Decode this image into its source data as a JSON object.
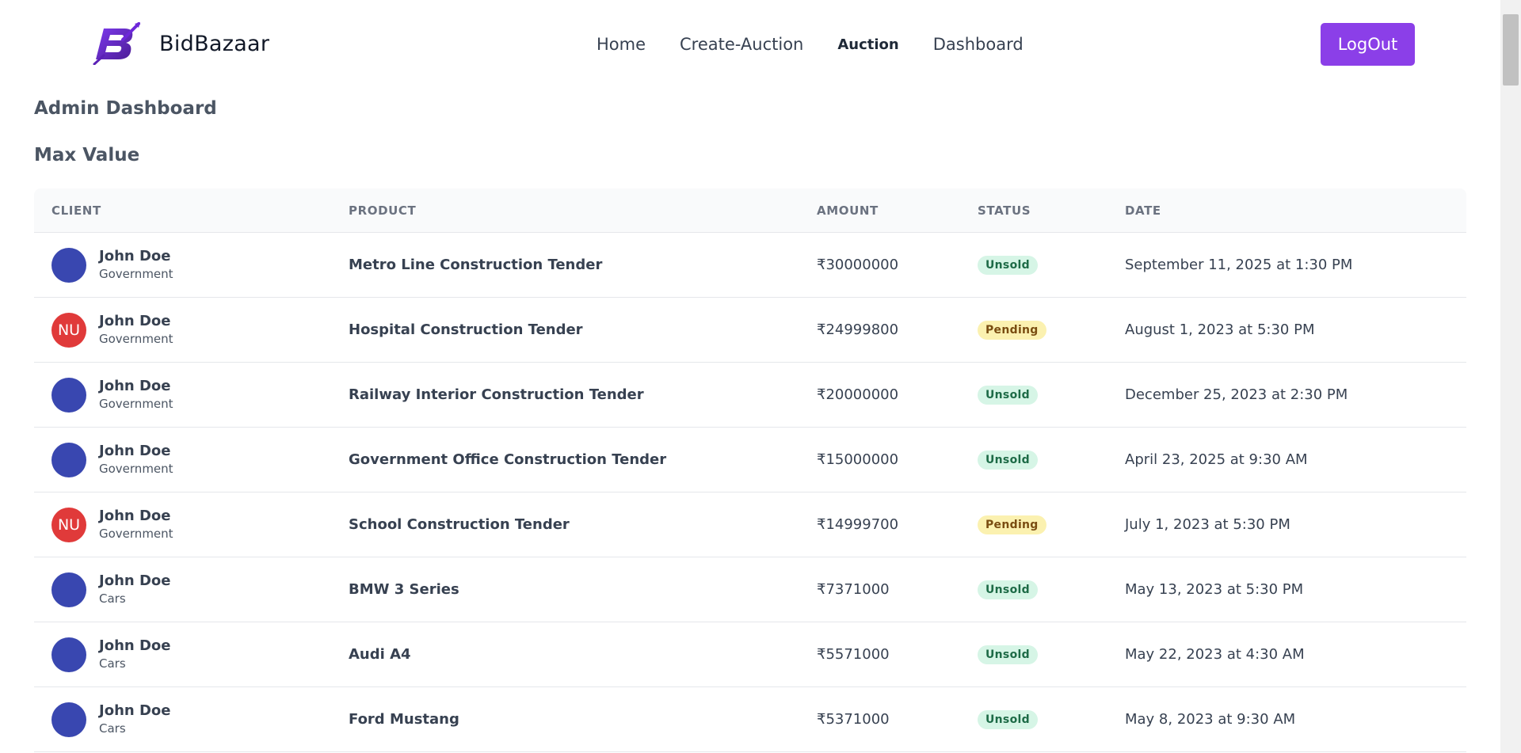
{
  "header": {
    "brand_name": "BidBazaar",
    "nav": [
      {
        "label": "Home"
      },
      {
        "label": "Create-Auction"
      },
      {
        "label": "Auction"
      },
      {
        "label": "Dashboard"
      }
    ],
    "logout_label": "LogOut"
  },
  "page_title": "Admin Dashboard",
  "section_title": "Max Value",
  "table": {
    "columns": [
      "CLIENT",
      "PRODUCT",
      "AMOUNT",
      "STATUS",
      "DATE"
    ],
    "rows": [
      {
        "client_name": "John Doe",
        "client_category": "Government",
        "avatar_initials": "",
        "product": "Metro Line Construction Tender",
        "amount": "₹30000000",
        "status": "Unsold",
        "date": "September 11, 2025 at 1:30 PM"
      },
      {
        "client_name": "John Doe",
        "client_category": "Government",
        "avatar_initials": "NU",
        "product": "Hospital Construction Tender",
        "amount": "₹24999800",
        "status": "Pending",
        "date": "August 1, 2023 at 5:30 PM"
      },
      {
        "client_name": "John Doe",
        "client_category": "Government",
        "avatar_initials": "",
        "product": "Railway Interior Construction Tender",
        "amount": "₹20000000",
        "status": "Unsold",
        "date": "December 25, 2023 at 2:30 PM"
      },
      {
        "client_name": "John Doe",
        "client_category": "Government",
        "avatar_initials": "",
        "product": "Government Office Construction Tender",
        "amount": "₹15000000",
        "status": "Unsold",
        "date": "April 23, 2025 at 9:30 AM"
      },
      {
        "client_name": "John Doe",
        "client_category": "Government",
        "avatar_initials": "NU",
        "product": "School Construction Tender",
        "amount": "₹14999700",
        "status": "Pending",
        "date": "July 1, 2023 at 5:30 PM"
      },
      {
        "client_name": "John Doe",
        "client_category": "Cars",
        "avatar_initials": "",
        "product": "BMW 3 Series",
        "amount": "₹7371000",
        "status": "Unsold",
        "date": "May 13, 2023 at 5:30 PM"
      },
      {
        "client_name": "John Doe",
        "client_category": "Cars",
        "avatar_initials": "",
        "product": "Audi A4",
        "amount": "₹5571000",
        "status": "Unsold",
        "date": "May 22, 2023 at 4:30 AM"
      },
      {
        "client_name": "John Doe",
        "client_category": "Cars",
        "avatar_initials": "",
        "product": "Ford Mustang",
        "amount": "₹5371000",
        "status": "Unsold",
        "date": "May 8, 2023 at 9:30 AM"
      }
    ]
  },
  "colors": {
    "accent": "#8b3fe8",
    "avatar_default": "#3947b0",
    "avatar_initials": "#e03a3a",
    "unsold_bg": "#d6f5e6",
    "pending_bg": "#fbf1b0"
  }
}
